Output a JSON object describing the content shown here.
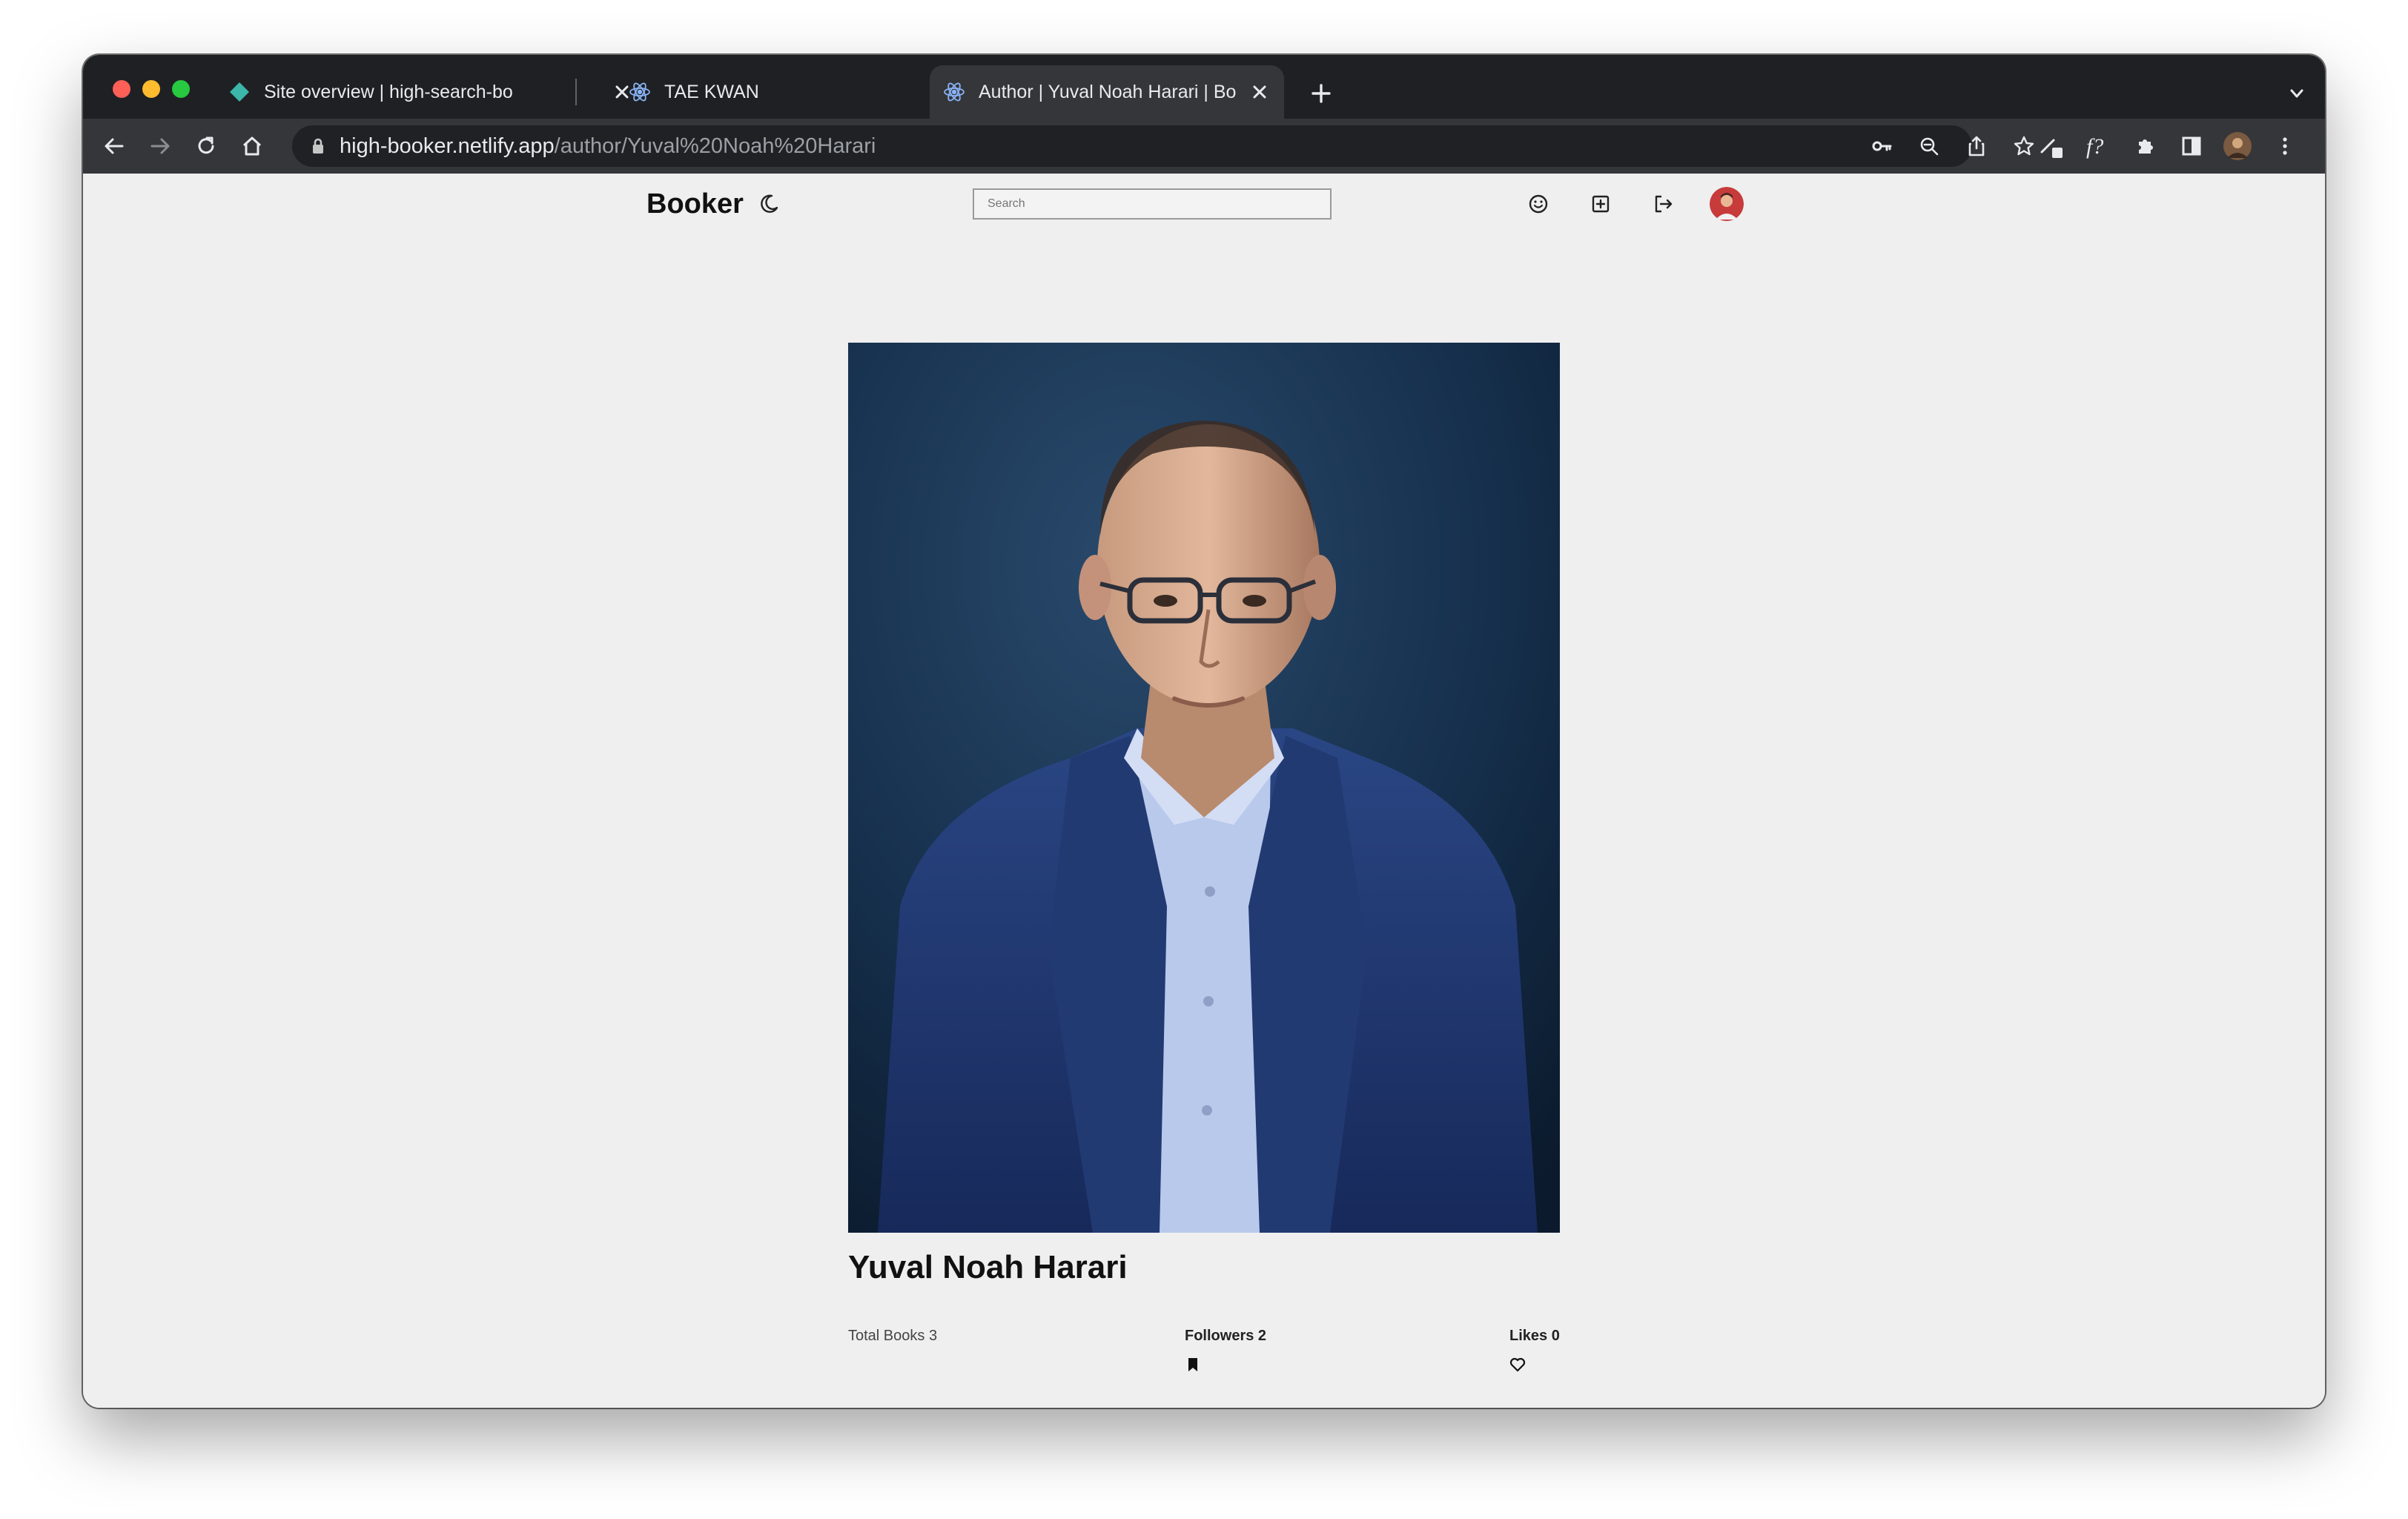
{
  "browser": {
    "tabs": [
      {
        "title": "Site overview | high-search-bo",
        "icon": "netlify-diamond-icon",
        "active": false
      },
      {
        "title": "TAE KWAN",
        "icon": "react-atom-icon",
        "active": false
      },
      {
        "title": "Author | Yuval Noah Harari | Bo",
        "icon": "react-atom-icon",
        "active": true
      }
    ],
    "url_host": "high-booker.netlify.app",
    "url_path": "/author/Yuval%20Noah%20Harari"
  },
  "header": {
    "brand": "Booker",
    "search_placeholder": "Search"
  },
  "author": {
    "name": "Yuval Noah Harari",
    "total_books_label": "Total Books 3",
    "followers_label": "Followers 2",
    "likes_label": "Likes 0"
  },
  "colors": {
    "tabstrip": "#1f2023",
    "toolbar": "#35363a",
    "page_background": "#efefef",
    "portrait_background": "#16304d",
    "suit": "#1e3568",
    "shirt": "#b9c9ec"
  }
}
